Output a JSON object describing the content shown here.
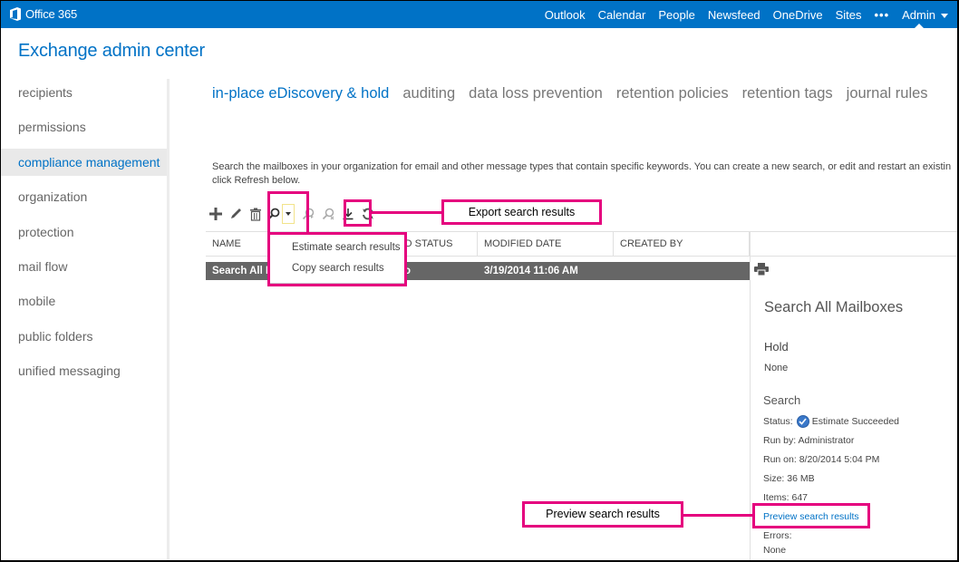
{
  "topbar": {
    "brand": "Office 365",
    "nav": [
      "Outlook",
      "Calendar",
      "People",
      "Newsfeed",
      "OneDrive",
      "Sites"
    ],
    "more": "•••",
    "admin": "Admin",
    "color": "#0072c6"
  },
  "app_title": "Exchange admin center",
  "sidebar": {
    "items": [
      {
        "label": "recipients"
      },
      {
        "label": "permissions"
      },
      {
        "label": "compliance management",
        "active": true
      },
      {
        "label": "organization"
      },
      {
        "label": "protection"
      },
      {
        "label": "mail flow"
      },
      {
        "label": "mobile"
      },
      {
        "label": "public folders"
      },
      {
        "label": "unified messaging"
      }
    ]
  },
  "tabs": [
    {
      "label": "in-place eDiscovery & hold",
      "active": true
    },
    {
      "label": "auditing"
    },
    {
      "label": "data loss prevention"
    },
    {
      "label": "retention policies"
    },
    {
      "label": "retention tags"
    },
    {
      "label": "journal rules"
    }
  ],
  "description": {
    "line1": "Search the mailboxes in your organization for email and other message types that contain specific keywords. You can create a new search, or edit and restart an existin",
    "line2": "click Refresh below."
  },
  "toolbar": {
    "icons": [
      "add-icon",
      "edit-icon",
      "delete-icon",
      "search-icon",
      "dropdown-caret-icon",
      "restart-search-icon",
      "stop-search-icon",
      "export-icon",
      "refresh-icon"
    ]
  },
  "search_menu": {
    "items": [
      "Estimate search results",
      "Copy search results"
    ]
  },
  "table": {
    "columns": [
      "NAME",
      "HOLD STATUS",
      "MODIFIED DATE",
      "CREATED BY"
    ],
    "visible_header_fragment": "OLD STATUS",
    "rows": [
      {
        "name": "Search All M",
        "hold_status": "o",
        "modified_date": "3/19/2014 11:06 AM",
        "created_by": "",
        "selected": true
      }
    ]
  },
  "details": {
    "title": "Search All Mailboxes",
    "hold_label": "Hold",
    "hold_value": "None",
    "search_label": "Search",
    "status_label": "Status:",
    "status_value": "Estimate Succeeded",
    "run_by": "Run by: Administrator",
    "run_on": "Run on: 8/20/2014 5:04 PM",
    "size": "Size: 36 MB",
    "items": "Items: 647",
    "preview_link": "Preview search results",
    "errors_label": "Errors:",
    "errors_value": "None"
  },
  "annotations": {
    "export": "Export search results",
    "preview": "Preview search results",
    "color": "#e5007e"
  }
}
